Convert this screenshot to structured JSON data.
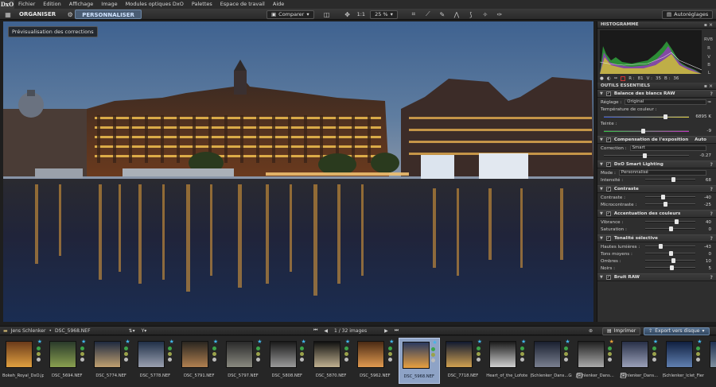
{
  "app": {
    "logo": "DxO"
  },
  "menu": [
    "Fichier",
    "Edition",
    "Affichage",
    "Image",
    "Modules optiques DxO",
    "Palettes",
    "Espace de travail",
    "Aide"
  ],
  "toolbar": {
    "tab_organiser": "ORGANISER",
    "tab_personnaliser": "PERSONNALISER",
    "compare_label": "Comparer",
    "ratio_label": "1:1",
    "zoom_label": "25 %",
    "presets_label": "Autoréglages"
  },
  "viewer": {
    "preview_label": "Prévisualisation des corrections"
  },
  "histogram": {
    "title": "HISTOGRAMME",
    "channels": [
      "RVB",
      "R",
      "V",
      "B",
      "L"
    ],
    "readout": {
      "r_label": "R :",
      "r": "81",
      "v_label": "V :",
      "v": "35",
      "b_label": "B :",
      "b": "36"
    }
  },
  "tools": {
    "title": "OUTILS ESSENTIELS",
    "white_balance": {
      "title": "Balance des blancs RAW",
      "setting_label": "Réglage :",
      "setting_value": "Original",
      "temp_label": "Température de couleur :",
      "temp_value": "6895 K",
      "temp_pos": 0.72,
      "tint_label": "Teinte :",
      "tint_value": "-9",
      "tint_pos": 0.46
    },
    "exposure": {
      "title": "Compensation de l'exposition",
      "auto": "Auto",
      "correction_label": "Correction :",
      "correction_value": "Smart",
      "slider_value": "-0.27",
      "slider_pos": 0.48
    },
    "smart_lighting": {
      "title": "DxO Smart Lighting",
      "mode_label": "Mode :",
      "mode_value": "Personnalisé",
      "intensity_label": "Intensité :",
      "intensity_value": "68",
      "intensity_pos": 0.55
    },
    "contrast": {
      "title": "Contraste",
      "contrast_label": "Contraste :",
      "contrast_value": "-40",
      "contrast_pos": 0.35,
      "micro_label": "Microcontraste :",
      "micro_value": "-25",
      "micro_pos": 0.4
    },
    "color_accent": {
      "title": "Accentuation des couleurs",
      "vibrance_label": "Vibrance :",
      "vibrance_value": "40",
      "vibrance_pos": 0.62,
      "saturation_label": "Saturation :",
      "saturation_value": "0",
      "saturation_pos": 0.5
    },
    "selective_tone": {
      "title": "Tonalité sélective",
      "highlights_label": "Hautes lumières :",
      "highlights_value": "-43",
      "highlights_pos": 0.3,
      "midtones_label": "Tons moyens :",
      "midtones_value": "0",
      "midtones_pos": 0.5,
      "shadows_label": "Ombres :",
      "shadows_value": "10",
      "shadows_pos": 0.55,
      "blacks_label": "Noirs :",
      "blacks_value": "5",
      "blacks_pos": 0.53
    },
    "raw_noise": {
      "title": "Bruit RAW"
    }
  },
  "filmbar": {
    "folder": "Jens Schlenker",
    "separator": "•",
    "file": "DSC_5968.NEF",
    "counter": "1 / 32",
    "counter_unit": "images",
    "print_label": "Imprimer",
    "export_label": "Export vers disque"
  },
  "filmstrip": [
    {
      "name": "Bokeh_Royal_DxO.jpg",
      "star": "blue",
      "c1": "#6a3a1a",
      "c2": "#e0a040"
    },
    {
      "name": "DSC_5694.NEF",
      "star": "blue",
      "c1": "#2a3a2a",
      "c2": "#8aa050"
    },
    {
      "name": "DSC_5774.NEF",
      "star": "blue",
      "c1": "#1e2a40",
      "c2": "#c0a070"
    },
    {
      "name": "DSC_5778.NEF",
      "star": "blue",
      "c1": "#203048",
      "c2": "#9aa0b0"
    },
    {
      "name": "DSC_5791.NEF",
      "star": "blue",
      "c1": "#2a2620",
      "c2": "#b08050"
    },
    {
      "name": "DSC_5797.NEF",
      "star": "blue",
      "c1": "#2a2a2a",
      "c2": "#8a8a80"
    },
    {
      "name": "DSC_5808.NEF",
      "star": "blue",
      "c1": "#1a1a1a",
      "c2": "#9a9a9a"
    },
    {
      "name": "DSC_5870.NEF",
      "star": "blue",
      "c1": "#101010",
      "c2": "#c0b090"
    },
    {
      "name": "DSC_5962.NEF",
      "star": "blue",
      "c1": "#4a2a14",
      "c2": "#e09a50"
    },
    {
      "name": "DSC_5968.NEF",
      "star": "blue",
      "c1": "#2a3a60",
      "c2": "#e8a040",
      "selected": true
    },
    {
      "name": "DSC_7718.NEF",
      "star": "blue",
      "c1": "#101a30",
      "c2": "#d0a050"
    },
    {
      "name": "Heart_of_the_Lofoten...",
      "star": "blue",
      "c1": "#1a1a1a",
      "c2": "#d0d0d0"
    },
    {
      "name": "JSchlenker_Dans...Gra...",
      "star": "blue",
      "c1": "#1a2030",
      "c2": "#7a8090"
    },
    {
      "name": "JSchlenker_Dans...",
      "star": "orange",
      "c1": "#202020",
      "c2": "#aaaaaa",
      "num": "2"
    },
    {
      "name": "JSchlenker_Dans...",
      "star": "blue",
      "c1": "#283048",
      "c2": "#9aa0b8",
      "num": "2"
    },
    {
      "name": "JSchlenker_Iclet_Fier.j...",
      "star": "blue",
      "c1": "#102040",
      "c2": "#6080b0"
    },
    {
      "name": "...",
      "star": "blue",
      "c1": "#203050",
      "c2": "#8090a0"
    }
  ]
}
